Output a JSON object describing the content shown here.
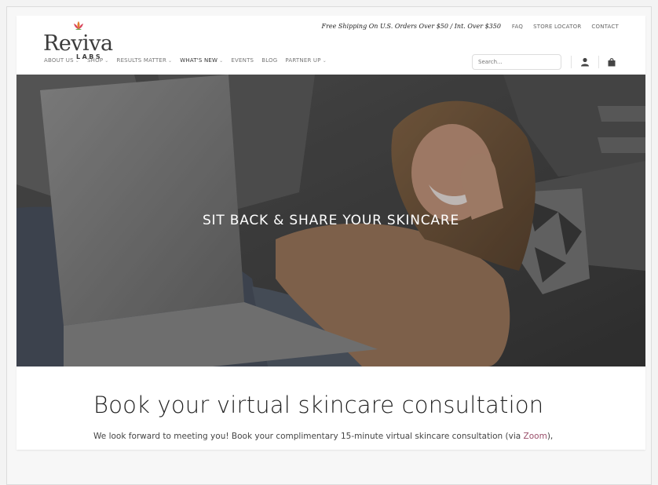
{
  "logo": {
    "name": "Reviva",
    "sub": "LABS"
  },
  "topbar": {
    "shipping": "Free Shipping On U.S. Orders Over $50 / Int. Over $350",
    "links": [
      "FAQ",
      "STORE LOCATOR",
      "CONTACT"
    ]
  },
  "nav": {
    "items": [
      {
        "label": "ABOUT US",
        "caret": true
      },
      {
        "label": "SHOP",
        "caret": true
      },
      {
        "label": "RESULTS MATTER",
        "caret": true
      },
      {
        "label": "WHAT'S NEW",
        "caret": true
      },
      {
        "label": "EVENTS",
        "caret": false
      },
      {
        "label": "BLOG",
        "caret": false
      },
      {
        "label": "PARTNER UP",
        "caret": true
      }
    ]
  },
  "search": {
    "placeholder": "Search..."
  },
  "hero": {
    "title": "SIT BACK & SHARE YOUR SKINCARE"
  },
  "content": {
    "heading": "Book your virtual skincare consultation",
    "para_before": "We look forward to meeting you! Book your complimentary 15-minute virtual skincare consultation (via ",
    "para_link": "Zoom",
    "para_after": "),"
  },
  "colors": {
    "link": "#9a4e6a",
    "heroText": "#ffffff"
  }
}
